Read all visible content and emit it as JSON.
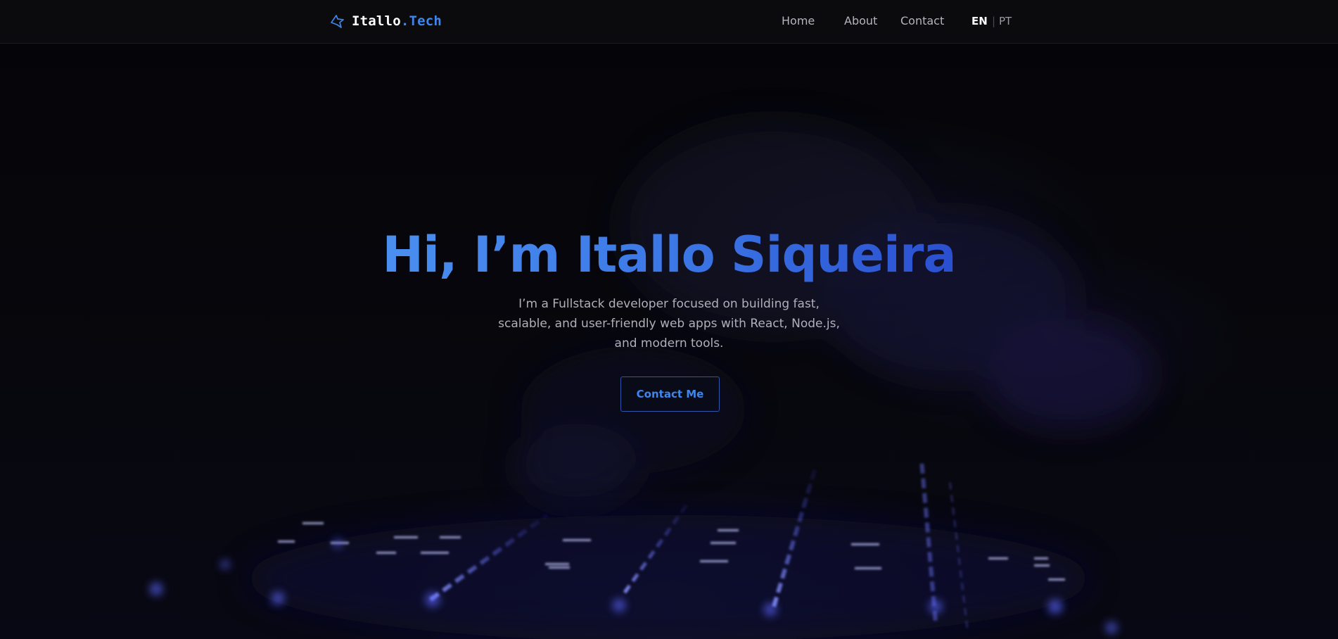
{
  "header": {
    "brand": {
      "icon": "logo-mark-icon",
      "name": "Itallo",
      "accent": ".Tech"
    },
    "nav": [
      {
        "label": "Home"
      },
      {
        "label": "About"
      },
      {
        "label": "Contact"
      }
    ],
    "languages": {
      "active": "EN",
      "separator": "|",
      "other": "PT"
    }
  },
  "hero": {
    "title": "Hi, I’m Itallo Siqueira",
    "description": "I’m a Fullstack developer focused on building fast, scalable, and user-friendly web apps with React, Node.js, and modern tools.",
    "cta_label": "Contact Me",
    "background": "keyboard-photo"
  },
  "colors": {
    "background": "#06060b",
    "header_bg": "#0b0b0d",
    "accent": "#3f86ea",
    "title_gradient_start": "#4a8ff0",
    "title_gradient_end": "#2a4fd0",
    "text_muted": "#b0b0ba"
  }
}
